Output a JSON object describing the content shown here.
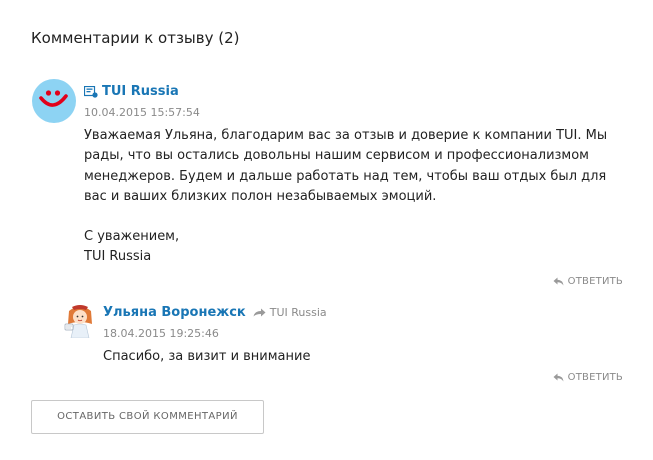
{
  "header": {
    "title": "Комментарии к отзыву (2)"
  },
  "comments": [
    {
      "author": "TUI Russia",
      "date": "10.04.2015 15:57:54",
      "paragraphs": [
        "Уважаемая Ульяна, благодарим вас за отзыв и доверие к компании TUI. Мы рады, что вы остались довольны нашим сервисом и профессионализмом менеджеров. Будем и дальше работать над тем, чтобы ваш отдых был для вас и ваших близких полон незабываемых эмоций.",
        "С уважением,",
        "TUI Russia"
      ],
      "reply_label": "ОТВЕТИТЬ"
    },
    {
      "author": "Ульяна Воронежск",
      "reply_to": "TUI Russia",
      "date": "18.04.2015 19:25:46",
      "text": "Спасибо, за визит и внимание",
      "reply_label": "ОТВЕТИТЬ"
    }
  ],
  "actions": {
    "leave_comment": "ОСТАВИТЬ СВОЙ КОММЕНТАРИЙ"
  },
  "colors": {
    "link": "#1976b5",
    "muted": "#8a8a8a",
    "tui_avatar_bg": "#8dd3f3",
    "tui_logo": "#e2001a"
  }
}
